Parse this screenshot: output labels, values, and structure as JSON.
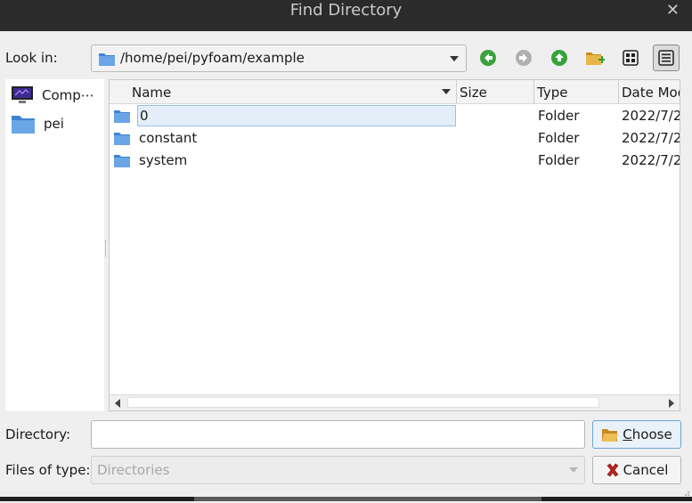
{
  "window": {
    "title": "Find Directory"
  },
  "toolbar": {
    "look_in_label": "Look in:",
    "path": "/home/pei/pyfoam/example",
    "buttons": [
      "back",
      "forward",
      "parent",
      "new-folder",
      "list-view",
      "detail-view"
    ]
  },
  "sidebar": {
    "items": [
      {
        "label": "Comp⋯",
        "icon": "computer-icon"
      },
      {
        "label": "pei",
        "icon": "folder-icon"
      }
    ]
  },
  "list": {
    "columns": [
      "Name",
      "Size",
      "Type",
      "Date Mod"
    ],
    "rows": [
      {
        "name": "0",
        "size": "",
        "type": "Folder",
        "date": "2022/7/2"
      },
      {
        "name": "constant",
        "size": "",
        "type": "Folder",
        "date": "2022/7/2"
      },
      {
        "name": "system",
        "size": "",
        "type": "Folder",
        "date": "2022/7/2"
      }
    ]
  },
  "form": {
    "directory_label": "Directory:",
    "directory_value": "",
    "filetype_label": "Files of type:",
    "filetype_value": "Directories"
  },
  "actions": {
    "choose_mnemonic": "C",
    "choose_rest": "hoose",
    "cancel_label": "Cancel"
  },
  "colors": {
    "accent": "#4a7fc1",
    "folder": "#3d82d3",
    "green_nav": "#3aa23a"
  }
}
